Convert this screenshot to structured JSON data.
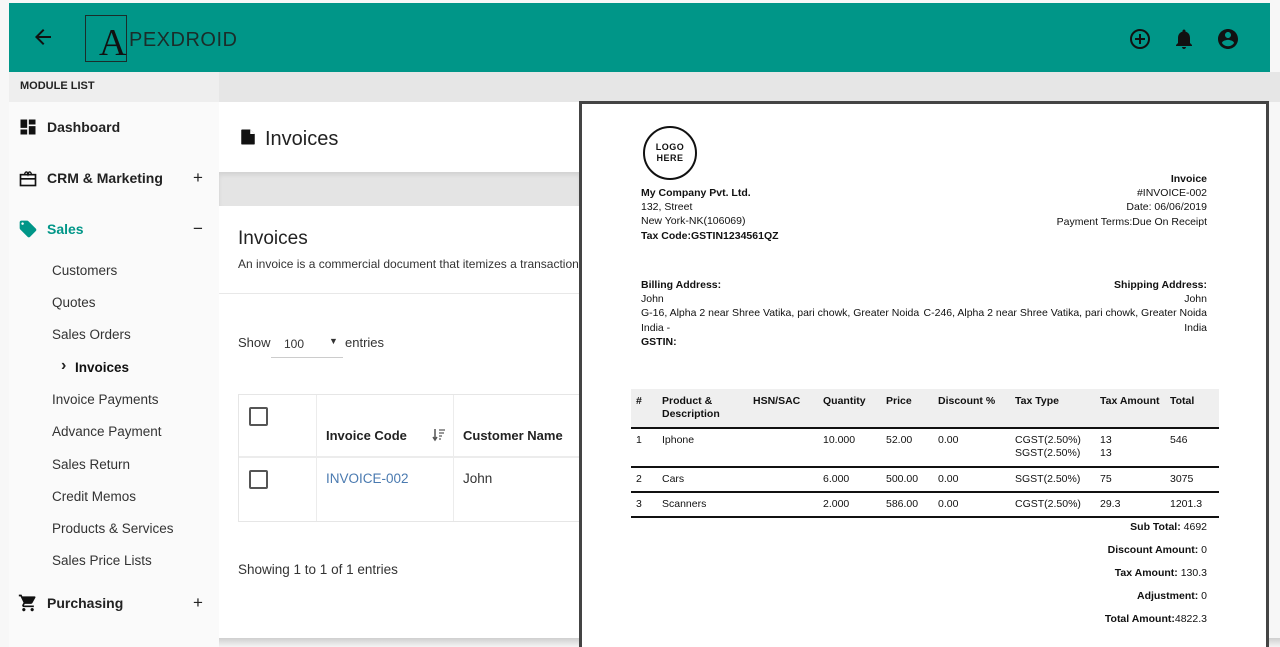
{
  "header": {
    "logo_letter": "A",
    "logo_text": "PEXDROID",
    "icons": [
      "back-arrow-icon",
      "add-circle-icon",
      "bell-icon",
      "account-circle-icon"
    ],
    "brand_color": "#009688"
  },
  "sidebar": {
    "heading": "MODULE LIST",
    "items": [
      {
        "label": "Dashboard",
        "icon": "dashboard-icon",
        "toggle": ""
      },
      {
        "label": "CRM & Marketing",
        "icon": "crm-icon",
        "toggle": "+"
      },
      {
        "label": "Sales",
        "icon": "tag-icon",
        "toggle": "−",
        "active": true
      },
      {
        "label": "Purchasing",
        "icon": "cart-icon",
        "toggle": "+"
      }
    ],
    "sales_subitems": [
      "Customers",
      "Quotes",
      "Sales Orders",
      "Invoices",
      "Invoice Payments",
      "Advance Payment",
      "Sales Return",
      "Credit Memos",
      "Products & Services",
      "Sales Price Lists"
    ],
    "current_marker": "›"
  },
  "page": {
    "title": "Invoices",
    "card_title": "Invoices",
    "description": "An invoice is a commercial document that itemizes a transaction be",
    "show_label": "Show",
    "entries_value": "100",
    "entries_label": "entries",
    "table": {
      "columns": [
        "Invoice Code",
        "Customer Name"
      ],
      "rows": [
        {
          "invoice_code": "INVOICE-002",
          "customer_name": "John"
        }
      ]
    },
    "showing_text": "Showing 1 to 1 of 1 entries"
  },
  "invoice": {
    "logo_line1": "LOGO",
    "logo_line2": "HERE",
    "company": {
      "name": "My Company Pvt. Ltd.",
      "street": "132, Street",
      "city": "New York-NK(106069)",
      "tax_code": "Tax Code:GSTIN1234561QZ"
    },
    "meta": {
      "title": "Invoice",
      "number": "#INVOICE-002",
      "date": "Date: 06/06/2019",
      "terms": "Payment Terms:Due On Receipt"
    },
    "billing": {
      "label": "Billing Address:",
      "name": "John",
      "address": "G-16, Alpha 2 near Shree Vatika, pari chowk, Greater Noida",
      "country": "India -",
      "gstin": "GSTIN:"
    },
    "shipping": {
      "label": "Shipping Address:",
      "name": "John",
      "address": "C-246, Alpha 2 near Shree Vatika, pari chowk, Greater Noida",
      "country": "India"
    },
    "columns": [
      "#",
      "Product & Description",
      "HSN/SAC",
      "Quantity",
      "Price",
      "Discount %",
      "Tax Type",
      "Tax Amount",
      "Total"
    ],
    "items": [
      {
        "no": "1",
        "product": "Iphone",
        "hsn": "",
        "qty": "10.000",
        "price": "52.00",
        "discount": "0.00",
        "tax_type_1": "CGST(2.50%)",
        "tax_type_2": "SGST(2.50%)",
        "tax_amount_1": "13",
        "tax_amount_2": "13",
        "total": "546"
      },
      {
        "no": "2",
        "product": "Cars",
        "hsn": "",
        "qty": "6.000",
        "price": "500.00",
        "discount": "0.00",
        "tax_type_1": "SGST(2.50%)",
        "tax_amount_1": "75",
        "total": "3075"
      },
      {
        "no": "3",
        "product": "Scanners",
        "hsn": "",
        "qty": "2.000",
        "price": "586.00",
        "discount": "0.00",
        "tax_type_1": "CGST(2.50%)",
        "tax_amount_1": "29.3",
        "total": "1201.3"
      }
    ],
    "totals": {
      "sub_total_label": "Sub Total:",
      "sub_total": "4692",
      "discount_label": "Discount Amount:",
      "discount": "0",
      "tax_label": "Tax Amount:",
      "tax": "130.3",
      "adjustment_label": "Adjustment:",
      "adjustment": "0",
      "total_label": "Total Amount:",
      "total": "4822.3"
    }
  }
}
